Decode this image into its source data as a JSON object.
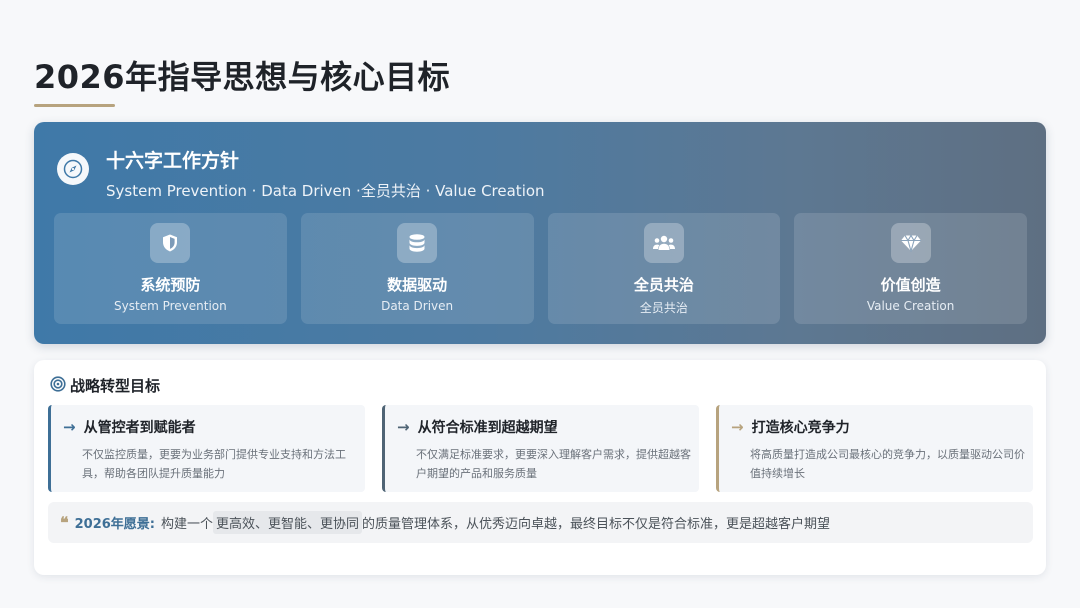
{
  "page": {
    "title": "2026年指导思想与核心目标"
  },
  "banner": {
    "icon": "compass-icon",
    "title": "十六字工作方针",
    "subtitle": "System Prevention · Data Driven ·全员共治 · Value Creation",
    "pillars": [
      {
        "icon": "shield-icon",
        "title": "系统预防",
        "subtitle": "System Prevention"
      },
      {
        "icon": "database-icon",
        "title": "数据驱动",
        "subtitle": "Data Driven"
      },
      {
        "icon": "users-icon",
        "title": "全员共治",
        "subtitle": "全员共治"
      },
      {
        "icon": "gem-icon",
        "title": "价值创造",
        "subtitle": "Value Creation"
      }
    ]
  },
  "goals": {
    "icon": "target-icon",
    "heading": "战略转型目标",
    "items": [
      {
        "icon": "arrow-right-icon",
        "title": "从管控者到赋能者",
        "description": "不仅监控质量，更要为业务部门提供专业支持和方法工具，帮助各团队提升质量能力",
        "accent": "#3e6f96"
      },
      {
        "icon": "arrow-right-icon",
        "title": "从符合标准到超越期望",
        "description": "不仅满足标准要求，更要深入理解客户需求，提供超越客户期望的产品和服务质量",
        "accent": "#4f6475"
      },
      {
        "icon": "arrow-right-icon",
        "title": "打造核心竞争力",
        "description": "将高质量打造成公司最核心的竞争力，以质量驱动公司价值持续增长",
        "accent": "#b7a37e"
      }
    ]
  },
  "vision": {
    "icon": "quote-icon",
    "label": "2026年愿景:",
    "text_before": "构建一个",
    "highlight": "更高效、更智能、更协同",
    "text_after": "的质量管理体系，从优秀迈向卓越，最终目标不仅是符合标准，更是超越客户期望"
  }
}
